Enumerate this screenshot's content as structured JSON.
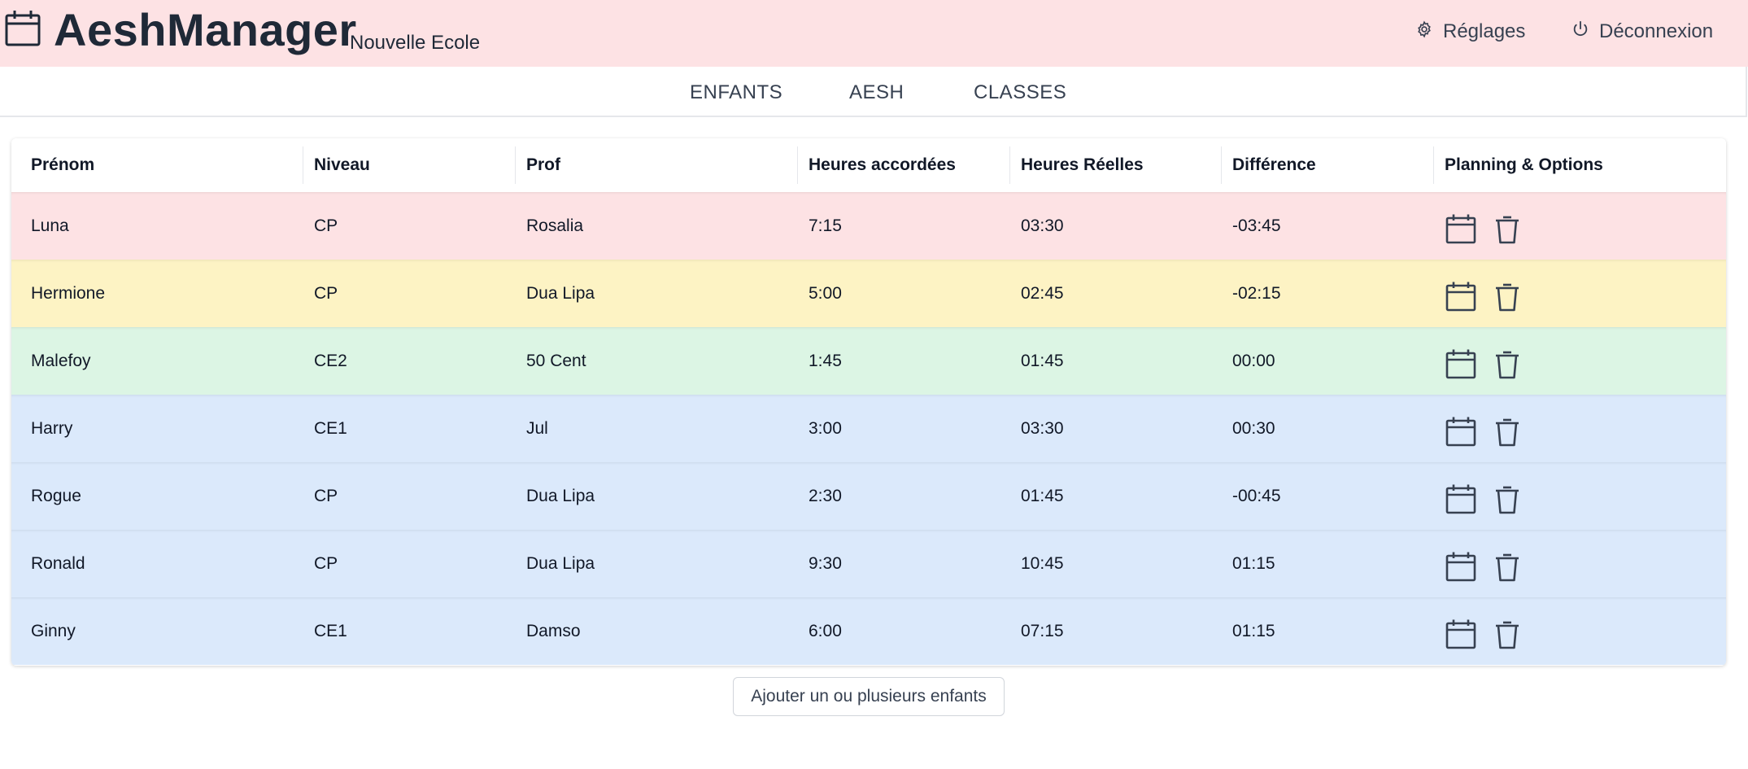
{
  "header": {
    "app_title": "AeshManager",
    "school_name": "Nouvelle Ecole",
    "settings_label": "Réglages",
    "logout_label": "Déconnexion",
    "background": "#fde2e4"
  },
  "nav": {
    "tabs": [
      {
        "label": "ENFANTS"
      },
      {
        "label": "AESH"
      },
      {
        "label": "CLASSES"
      }
    ]
  },
  "table": {
    "columns": [
      "Prénom",
      "Niveau",
      "Prof",
      "Heures accordées",
      "Heures Réelles",
      "Différence",
      "Planning & Options"
    ],
    "rows": [
      {
        "prenom": "Luna",
        "niveau": "CP",
        "prof": "Rosalia",
        "accordees": "7:15",
        "reelles": "03:30",
        "difference": "-03:45",
        "color": "red"
      },
      {
        "prenom": "Hermione",
        "niveau": "CP",
        "prof": "Dua Lipa",
        "accordees": "5:00",
        "reelles": "02:45",
        "difference": "-02:15",
        "color": "yellow"
      },
      {
        "prenom": "Malefoy",
        "niveau": "CE2",
        "prof": "50 Cent",
        "accordees": "1:45",
        "reelles": "01:45",
        "difference": "00:00",
        "color": "green"
      },
      {
        "prenom": "Harry",
        "niveau": "CE1",
        "prof": "Jul",
        "accordees": "3:00",
        "reelles": "03:30",
        "difference": "00:30",
        "color": "blue"
      },
      {
        "prenom": "Rogue",
        "niveau": "CP",
        "prof": "Dua Lipa",
        "accordees": "2:30",
        "reelles": "01:45",
        "difference": "-00:45",
        "color": "blue"
      },
      {
        "prenom": "Ronald",
        "niveau": "CP",
        "prof": "Dua Lipa",
        "accordees": "9:30",
        "reelles": "10:45",
        "difference": "01:15",
        "color": "blue"
      },
      {
        "prenom": "Ginny",
        "niveau": "CE1",
        "prof": "Damso",
        "accordees": "6:00",
        "reelles": "07:15",
        "difference": "01:15",
        "color": "blue"
      }
    ],
    "row_icons": [
      "calendar-icon",
      "trash-icon"
    ],
    "status_colors": {
      "red": "#fde2e4",
      "yellow": "#fdf3c4",
      "green": "#dcf5e4",
      "blue": "#dbe9fb"
    }
  },
  "actions": {
    "add_children_label": "Ajouter un ou plusieurs enfants"
  }
}
